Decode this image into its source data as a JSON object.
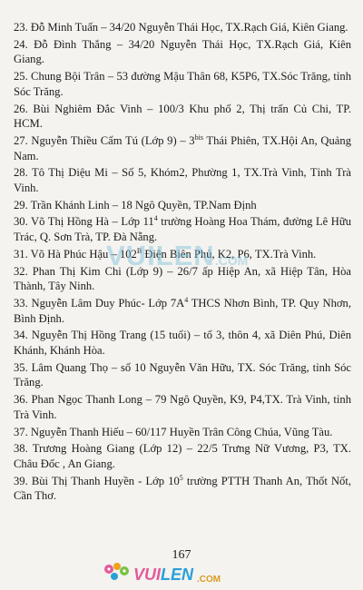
{
  "entries": [
    {
      "pre": "23. Đỗ Minh Tuấn – 34/20 Nguyễn Thái Học, TX.Rạch Giá, Kiên Giang."
    },
    {
      "pre": "24. Đỗ Đình Thắng – 34/20 Nguyễn Thái Học, TX.Rạch Giá, Kiên Giang."
    },
    {
      "pre": "25. Chung Bội Trân – 53 đường Mậu Thân 68, K5P6, TX.Sóc Trăng, tỉnh Sóc Trăng."
    },
    {
      "pre": "26. Bùi Nghiêm Đắc Vinh – 100/3 Khu phố 2, Thị trấn Củ Chi, TP. HCM."
    },
    {
      "pre": "27. Nguyễn Thiều Cẩm Tú (Lớp 9) – 3",
      "sup": "bis",
      "post": " Thái Phiên, TX.Hội An, Quảng Nam."
    },
    {
      "pre": "28. Tô Thị Diệu Mi – Số 5, Khóm2, Phường 1, TX.Trà Vinh, Tỉnh Trà Vinh."
    },
    {
      "pre": "29. Trần Khánh Linh – 18 Ngô Quyền, TP.Nam Định"
    },
    {
      "pre": "30. Võ Thị Hồng Hà – Lớp 11",
      "sup": "4",
      "post": " trường Hoàng Hoa Thám, đường Lê Hữu Trác, Q. Sơn Trà, TP. Đà Nẵng."
    },
    {
      "pre": "31. Võ Hà Phúc Hậu – 102",
      "sup": "B",
      "post": " Điện Biên Phủ, K2, P6, TX.Trà Vinh."
    },
    {
      "pre": "32. Phan Thị Kim Chi (Lớp 9) – 26/7 ấp Hiệp An, xã Hiệp Tân, Hòa Thành, Tây Ninh."
    },
    {
      "pre": "33. Nguyễn Lâm Duy Phúc- Lớp 7A",
      "sup": "4",
      "post": " THCS Nhơn Bình, TP. Quy Nhơn, Bình Định."
    },
    {
      "pre": "34. Nguyễn Thị Hồng Trang (15 tuổi) – tổ 3, thôn 4, xã Diên Phú, Diên Khánh, Khánh Hòa."
    },
    {
      "pre": "35. Lâm Quang Thọ – số 10 Nguyễn Văn Hữu, TX. Sóc Trăng, tỉnh Sóc Trăng."
    },
    {
      "pre": "36. Phan Ngọc Thanh Long – 79 Ngô Quyền, K9, P4,TX. Trà Vinh, tỉnh Trà Vinh."
    },
    {
      "pre": "37. Nguyễn Thanh Hiếu – 60/117 Huyền Trân Công Chúa, Vũng Tàu."
    },
    {
      "pre": "38. Trương Hoàng Giang (Lớp 12) – 22/5 Trưng Nữ Vương, P3, TX. Châu Đốc , An Giang."
    },
    {
      "pre": "39. Bùi Thị Thanh Huyền - Lớp 10",
      "sup": "5",
      "post": " trường PTTH Thanh An, Thốt Nốt, Cần Thơ."
    }
  ],
  "watermark": {
    "text": "VUILEN",
    "suffix": ".COM"
  },
  "page_number": "167",
  "footer_logo": {
    "part1": "VUI",
    "part2": "LEN",
    "suffix": ".COM"
  },
  "colors": {
    "background": "#f4f3ef",
    "text": "#1b1b1b",
    "watermark": "#78bedc",
    "logo_pink": "#e35a9a",
    "logo_blue": "#2aa0d8"
  }
}
